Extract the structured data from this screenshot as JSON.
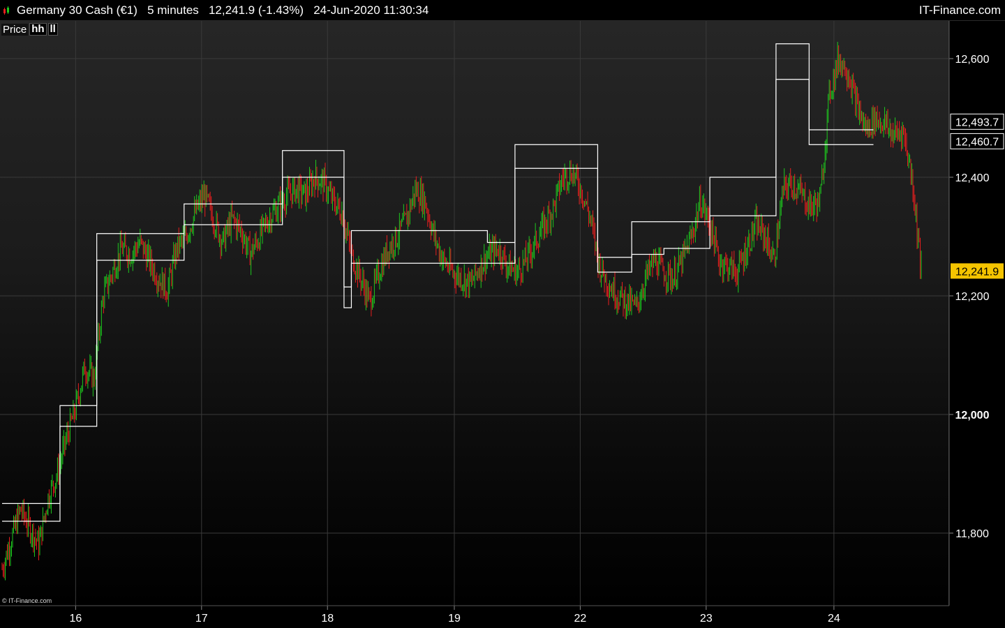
{
  "header": {
    "title": "Germany 30 Cash (€1)   5 minutes   12,241.9 (-1.43%)   24-Jun-2020 11:30:34",
    "brand": "IT-Finance.com"
  },
  "toolbar": {
    "price_label": "Price",
    "indicator_hh": "hh",
    "indicator_ll": "ll"
  },
  "copyright": "© IT-Finance.com",
  "colors": {
    "up_candle": "#1ec81e",
    "down_candle": "#e81e1e",
    "channel_line": "#ffffff",
    "last_price_badge": "#f5c400",
    "grid": "#3a3a3a"
  },
  "chart_data": {
    "type": "line",
    "title": "Germany 30 Cash (€1)",
    "xlabel": "",
    "ylabel": "",
    "x_ticks": [
      "16",
      "17",
      "18",
      "19",
      "22",
      "23",
      "24"
    ],
    "y_ticks": [
      "11,800",
      "12,000",
      "12,200",
      "12,400",
      "12,600"
    ],
    "y_tick_values": [
      11800,
      12000,
      12200,
      12400,
      12600
    ],
    "ylim": [
      11665,
      12650
    ],
    "grid": true,
    "price_labels": [
      {
        "text": "12,493.7",
        "value": 12493.7,
        "style": "outline"
      },
      {
        "text": "12,460.7",
        "value": 12460.7,
        "style": "outline"
      },
      {
        "text": "12,241.9",
        "value": 12241.9,
        "style": "highlight"
      }
    ],
    "price_series": {
      "name": "Price",
      "x_index_range": [
        0,
        100
      ],
      "values": [
        11740,
        11790,
        11840,
        11810,
        11780,
        11860,
        11900,
        11960,
        12010,
        12080,
        12060,
        12200,
        12240,
        12280,
        12270,
        12290,
        12260,
        12230,
        12210,
        12280,
        12300,
        12340,
        12370,
        12330,
        12290,
        12330,
        12310,
        12270,
        12300,
        12330,
        12350,
        12370,
        12380,
        12370,
        12400,
        12390,
        12360,
        12340,
        12270,
        12230,
        12190,
        12240,
        12280,
        12300,
        12330,
        12380,
        12360,
        12300,
        12260,
        12240,
        12230,
        12220,
        12250,
        12270,
        12280,
        12250,
        12240,
        12260,
        12290,
        12320,
        12350,
        12400,
        12410,
        12380,
        12330,
        12250,
        12220,
        12200,
        12190,
        12180,
        12230,
        12260,
        12240,
        12230,
        12260,
        12300,
        12360,
        12320,
        12260,
        12250,
        12240,
        12280,
        12320,
        12300,
        12260,
        12380,
        12390,
        12370,
        12350,
        12360,
        12540,
        12600,
        12580,
        12520,
        12480,
        12500,
        12490,
        12470,
        12480,
        12400,
        12241.9
      ]
    },
    "hh_series": {
      "name": "hh",
      "segments": [
        {
          "x": [
            0,
            6.3
          ],
          "value": 11850
        },
        {
          "x": [
            6.3,
            10.3
          ],
          "value": 12015
        },
        {
          "x": [
            10.3,
            19.8
          ],
          "value": 12305
        },
        {
          "x": [
            19.8,
            30.5
          ],
          "value": 12355
        },
        {
          "x": [
            30.5,
            37.2
          ],
          "value": 12445
        },
        {
          "x": [
            37.2,
            38.0
          ],
          "value": 12215
        },
        {
          "x": [
            38.0,
            52.8
          ],
          "value": 12310
        },
        {
          "x": [
            52.8,
            55.8
          ],
          "value": 12290
        },
        {
          "x": [
            55.8,
            64.8
          ],
          "value": 12455
        },
        {
          "x": [
            64.8,
            68.5
          ],
          "value": 12265
        },
        {
          "x": [
            68.5,
            72.0
          ],
          "value": 12325
        },
        {
          "x": [
            72.0,
            77.0
          ],
          "value": 12325
        },
        {
          "x": [
            77.0,
            84.2
          ],
          "value": 12400
        },
        {
          "x": [
            84.2,
            87.8
          ],
          "value": 12625
        },
        {
          "x": [
            87.8,
            94.8
          ],
          "value": 12480
        }
      ]
    },
    "ll_series": {
      "name": "ll",
      "segments": [
        {
          "x": [
            0,
            6.3
          ],
          "value": 11820
        },
        {
          "x": [
            6.3,
            10.3
          ],
          "value": 11980
        },
        {
          "x": [
            10.3,
            19.8
          ],
          "value": 12260
        },
        {
          "x": [
            19.8,
            30.5
          ],
          "value": 12320
        },
        {
          "x": [
            30.5,
            37.2
          ],
          "value": 12400
        },
        {
          "x": [
            37.2,
            38.0
          ],
          "value": 12180
        },
        {
          "x": [
            38.0,
            52.8
          ],
          "value": 12255
        },
        {
          "x": [
            52.8,
            55.8
          ],
          "value": 12255
        },
        {
          "x": [
            55.8,
            64.8
          ],
          "value": 12415
        },
        {
          "x": [
            64.8,
            68.5
          ],
          "value": 12240
        },
        {
          "x": [
            68.5,
            72.0
          ],
          "value": 12270
        },
        {
          "x": [
            72.0,
            77.0
          ],
          "value": 12280
        },
        {
          "x": [
            77.0,
            84.2
          ],
          "value": 12335
        },
        {
          "x": [
            84.2,
            87.8
          ],
          "value": 12565
        },
        {
          "x": [
            87.8,
            94.8
          ],
          "value": 12455
        }
      ]
    },
    "x_tick_positions_index": [
      8,
      21.7,
      35.4,
      49.2,
      62.9,
      76.6,
      90.5
    ]
  }
}
